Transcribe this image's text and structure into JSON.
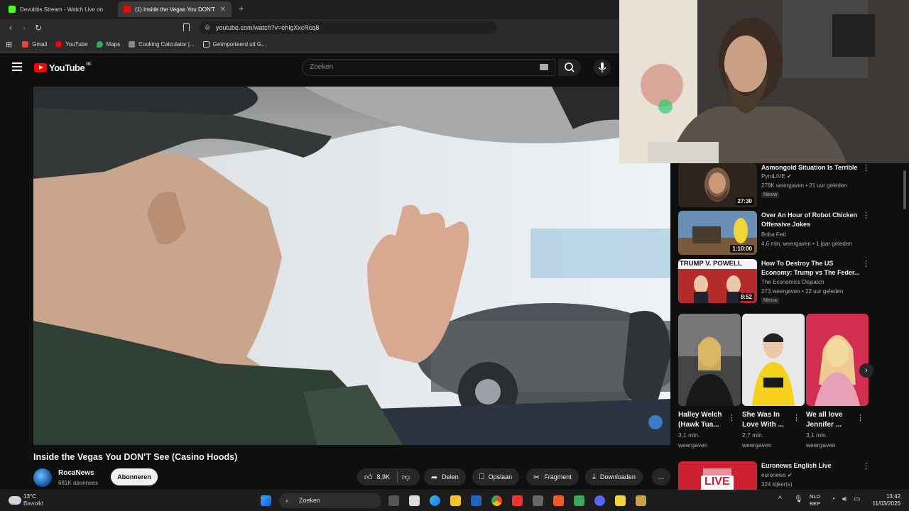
{
  "browser": {
    "tabs": [
      {
        "label": "Devubbs Stream - Watch Live on",
        "color": "#53fc18"
      },
      {
        "label": "(1) Inside the Vegas You DON'T",
        "color": "#ff0000"
      }
    ],
    "url": "youtube.com/watch?v=ehlgXxcRcq8",
    "bookmarks": [
      {
        "label": "Gmail",
        "color": "#ea4335"
      },
      {
        "label": "YouTube",
        "color": "#ff0000"
      },
      {
        "label": "Maps",
        "color": "#34a853"
      },
      {
        "label": "Cooking Calculator |...",
        "color": "#888888"
      },
      {
        "label": "Geïmporteerd uit G...",
        "color": "#cccccc"
      }
    ]
  },
  "youtube": {
    "logo_text": "YouTube",
    "region": "BE",
    "search_placeholder": "Zoeken"
  },
  "video": {
    "title": "Inside the Vegas You DON'T See (Casino Hoods)",
    "channel": "RocaNews",
    "subscribers": "681K abonnees",
    "subscribe_label": "Abonneren",
    "likes": "8,9K",
    "share_label": "Delen",
    "save_label": "Opslaan",
    "clip_label": "Fragment",
    "download_label": "Downloaden",
    "more_label": "…"
  },
  "recommendations": [
    {
      "title": "Asmongold Situation Is Terrible",
      "channel": "PyroLIVE",
      "verified": true,
      "meta": "278K weergaven • 21 uur geleden",
      "badge": "Nieuw",
      "duration": "27:30"
    },
    {
      "title": "Over An Hour of Robot Chicken Offensive Jokes",
      "channel": "Boba Fett",
      "verified": false,
      "meta": "4,6 mln. weergaven • 1 jaar geleden",
      "badge": "",
      "duration": "1:10:00"
    },
    {
      "title": "How To Destroy The US Economy: Trump vs The Feder...",
      "channel": "The Economics Dispatch",
      "verified": false,
      "meta": "273 weergaven • 22 uur geleden",
      "badge": "Nieuw",
      "duration": "8:52",
      "thumb_text": "TRUMP V. POWELL"
    },
    {
      "title": "Euronews English Live",
      "channel": "euronews",
      "verified": true,
      "meta": "324 kijker(s)",
      "badge": "",
      "duration": "",
      "thumb_text": "LIVE"
    }
  ],
  "shorts": [
    {
      "title": "Halley Welch (Hawk Tua...",
      "views": "3,1 mln.",
      "views2": "weergaven"
    },
    {
      "title": "She Was In Love With ...",
      "views": "2,7 mln.",
      "views2": "weergaven"
    },
    {
      "title": "We all love Jennifer ...",
      "views": "3,1 mln.",
      "views2": "weergaven"
    }
  ],
  "taskbar": {
    "temperature": "13°C",
    "weather": "Bewolkt",
    "search": "Zoeken",
    "lang1": "NLD",
    "lang2": "BEP",
    "time": "13:42",
    "date": "11/03/2026"
  }
}
